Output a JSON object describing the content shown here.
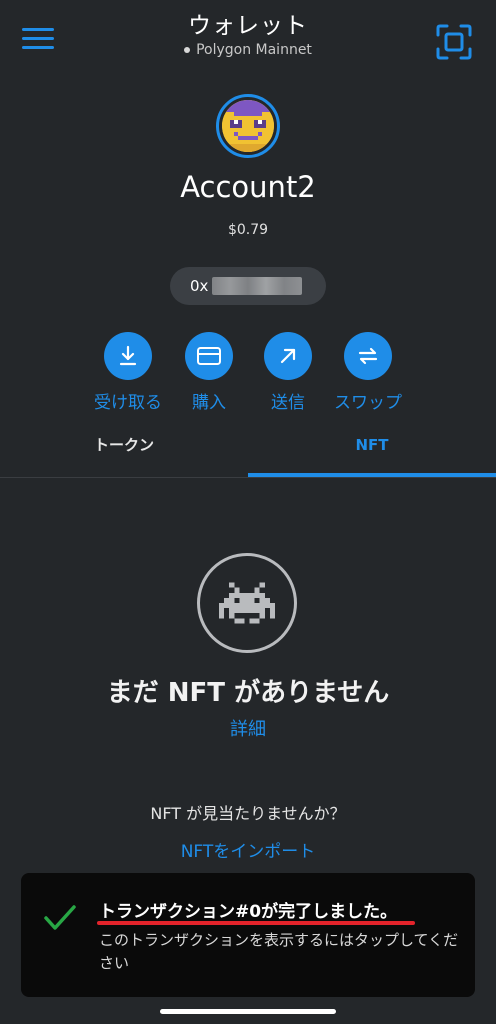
{
  "header": {
    "title": "ウォレット",
    "network": "Polygon Mainnet",
    "menu_icon": "hamburger-menu-icon",
    "scan_icon": "qr-scan-icon"
  },
  "account": {
    "name": "Account2",
    "balance": "$0.79",
    "address_prefix": "0x"
  },
  "actions": [
    {
      "label": "受け取る",
      "icon": "receive-icon"
    },
    {
      "label": "購入",
      "icon": "buy-card-icon"
    },
    {
      "label": "送信",
      "icon": "send-arrow-icon"
    },
    {
      "label": "スワップ",
      "icon": "swap-icon"
    }
  ],
  "tabs": [
    {
      "label": "トークン",
      "active": false
    },
    {
      "label": "NFT",
      "active": true
    }
  ],
  "empty_state": {
    "icon": "space-invader-icon",
    "title": "まだ NFT がありません",
    "learn_more": "詳細",
    "not_found": "NFT が見当たりませんか？",
    "import_link": "NFTをインポート"
  },
  "toast": {
    "icon": "checkmark-icon",
    "title": "トランザクション#0が完了しました。",
    "body": "このトランザクションを表示するにはタップしてください"
  },
  "colors": {
    "background": "#24272a",
    "accent": "#1f8de8",
    "success": "#28a745",
    "highlight": "#e3232b"
  }
}
